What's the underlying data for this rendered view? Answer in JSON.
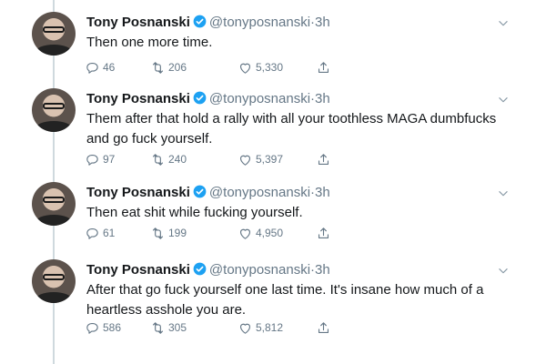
{
  "tweets": [
    {
      "name": "Tony Posnanski",
      "handle": "@tonyposnanski",
      "dot": "·",
      "time": "3h",
      "text": "Then one more time.",
      "replies": "46",
      "retweets": "206",
      "likes": "5,330"
    },
    {
      "name": "Tony Posnanski",
      "handle": "@tonyposnanski",
      "dot": "·",
      "time": "3h",
      "text": "Them after that hold a rally with all your toothless MAGA dumbfucks and go fuck yourself.",
      "replies": "97",
      "retweets": "240",
      "likes": "5,397"
    },
    {
      "name": "Tony Posnanski",
      "handle": "@tonyposnanski",
      "dot": "·",
      "time": "3h",
      "text": "Then eat shit while fucking yourself.",
      "replies": "61",
      "retweets": "199",
      "likes": "4,950"
    },
    {
      "name": "Tony Posnanski",
      "handle": "@tonyposnanski",
      "dot": "·",
      "time": "3h",
      "text": "After that go fuck yourself one last time. It's insane how much of a heartless asshole you are.",
      "replies": "586",
      "retweets": "305",
      "likes": "5,812"
    }
  ],
  "icons": {
    "verified": "verified-badge-icon",
    "caret": "chevron-down-icon",
    "reply": "reply-icon",
    "retweet": "retweet-icon",
    "like": "heart-icon",
    "share": "share-icon"
  },
  "colors": {
    "text": "#14171a",
    "muted": "#657786",
    "verified": "#1da1f2",
    "thread_line": "#cfd9de"
  }
}
